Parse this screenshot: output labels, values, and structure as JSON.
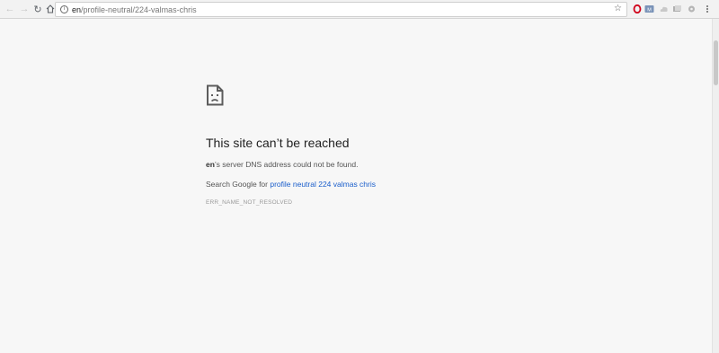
{
  "address_bar": {
    "host": "en",
    "path": "/profile-neutral/224-valmas-chris"
  },
  "error_page": {
    "title": "This site can’t be reached",
    "host_bold": "en",
    "dns_message": "’s server DNS address could not be found.",
    "search_prefix": "Search Google for ",
    "search_link": "profile neutral 224 valmas chris",
    "error_code": "ERR_NAME_NOT_RESOLVED"
  },
  "colors": {
    "link": "#1a5ecb",
    "background": "#f7f7f7",
    "opera_red": "#d0021b"
  },
  "icons": [
    "back-icon",
    "forward-icon",
    "reload-icon",
    "home-icon",
    "info-icon",
    "star-icon",
    "opera-icon",
    "extension-icon",
    "sad-page-icon"
  ]
}
